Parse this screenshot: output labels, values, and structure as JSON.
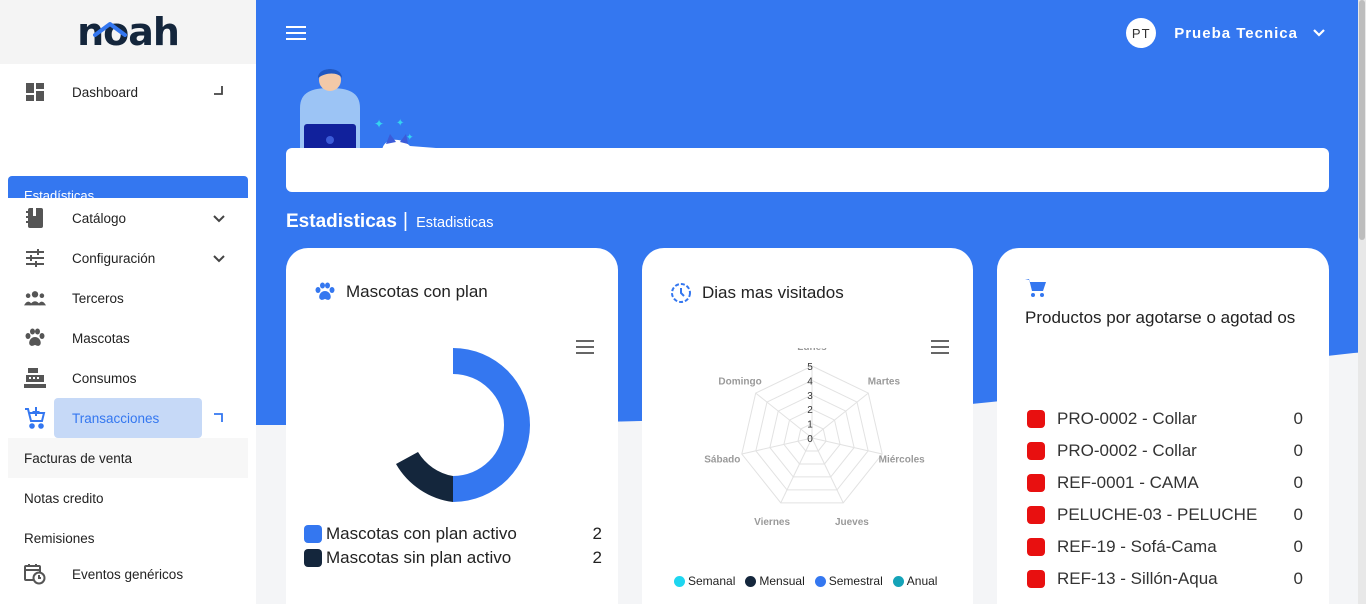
{
  "brand": {
    "logo_text": "noah"
  },
  "sidebar": {
    "items": [
      {
        "label": "Dashboard",
        "icon": "dashboard-icon"
      },
      {
        "label": "Estadísticas"
      },
      {
        "label": "Catálogo",
        "icon": "book-icon"
      },
      {
        "label": "Configuración",
        "icon": "sliders-icon"
      },
      {
        "label": "Terceros",
        "icon": "people-icon"
      },
      {
        "label": "Mascotas",
        "icon": "paw-icon"
      },
      {
        "label": "Consumos",
        "icon": "cash-register-icon"
      },
      {
        "label": "Transacciones",
        "icon": "cart-plus-icon"
      },
      {
        "label": "Facturas de venta"
      },
      {
        "label": "Notas credito"
      },
      {
        "label": "Remisiones"
      },
      {
        "label": "Eventos genéricos",
        "icon": "calendar-clock-icon"
      }
    ]
  },
  "header": {
    "avatar_initials": "PT",
    "user_name": "Prueba Tecnica"
  },
  "page": {
    "title": "Estadisticas",
    "separator": "|",
    "breadcrumb": "Estadisticas"
  },
  "cards": {
    "mascotas": {
      "title": "Mascotas con plan",
      "legend": [
        {
          "label": "Mascotas con plan activo",
          "value": "2",
          "color": "#3477f0"
        },
        {
          "label": "Mascotas sin plan activo",
          "value": "2",
          "color": "#14263c"
        }
      ]
    },
    "dias": {
      "title": "Dias mas visitados",
      "axes": [
        "Lunes",
        "Martes",
        "Miércoles",
        "Jueves",
        "Viernes",
        "Sábado",
        "Domingo"
      ],
      "scale": [
        "0",
        "1",
        "2",
        "3",
        "4",
        "5"
      ],
      "legend": [
        {
          "label": "Semanal",
          "color": "#1ed6f0"
        },
        {
          "label": "Mensual",
          "color": "#14263c"
        },
        {
          "label": "Semestral",
          "color": "#3477f0"
        },
        {
          "label": "Anual",
          "color": "#14a3b8"
        }
      ]
    },
    "productos": {
      "title": "Productos por agotarse o agotad os",
      "rows": [
        {
          "label": "PRO-0002 - Collar",
          "value": "0"
        },
        {
          "label": "PRO-0002 - Collar",
          "value": "0"
        },
        {
          "label": "REF-0001 - CAMA",
          "value": "0"
        },
        {
          "label": "PELUCHE-03 - PELUCHE",
          "value": "0"
        },
        {
          "label": "REF-19 - Sofá-Cama",
          "value": "0"
        },
        {
          "label": "REF-13 - Sillón-Aqua",
          "value": "0"
        }
      ]
    }
  },
  "colors": {
    "primary": "#3477f0",
    "dark": "#14263c",
    "danger": "#e81010"
  }
}
